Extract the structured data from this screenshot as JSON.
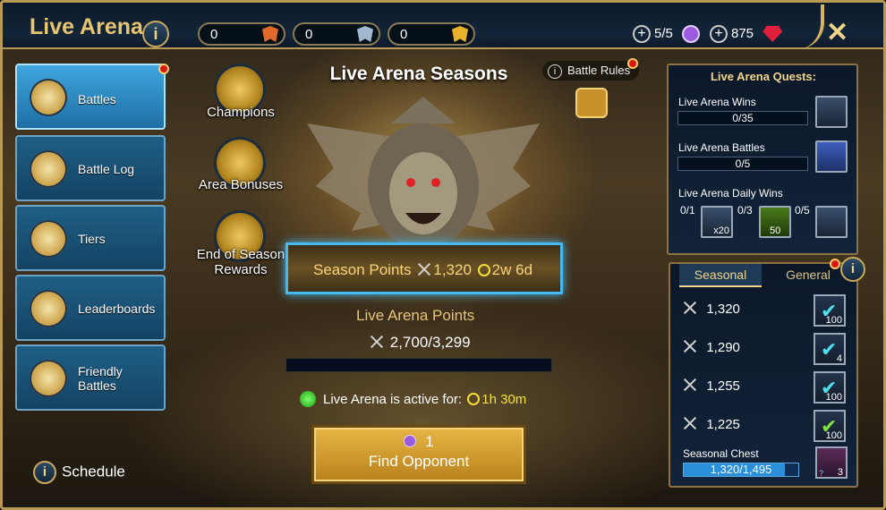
{
  "header": {
    "title": "Live Arena",
    "info_icon": "info-icon",
    "counters": [
      {
        "value": "0",
        "icon": "bronze-badge-icon",
        "color": "#e06a2a"
      },
      {
        "value": "0",
        "icon": "silver-badge-icon",
        "color": "#9fb8d0"
      },
      {
        "value": "0",
        "icon": "gold-badge-icon",
        "color": "#e8b22a"
      }
    ],
    "tokens": "5/5",
    "gems": "875",
    "close_icon": "close-icon"
  },
  "nav": [
    {
      "label": "Battles",
      "icon": "crossed-axes-icon",
      "active": true,
      "notify": true
    },
    {
      "label": "Battle Log",
      "icon": "scroll-icon",
      "active": false
    },
    {
      "label": "Tiers",
      "icon": "trophy-icon",
      "active": false
    },
    {
      "label": "Leaderboards",
      "icon": "double-trophy-icon",
      "active": false
    },
    {
      "label_line1": "Friendly",
      "label_line2": "Battles",
      "icon": "friendly-battles-icon",
      "active": false
    }
  ],
  "center": {
    "title": "Live Arena Seasons",
    "battle_rules": "Battle Rules",
    "champions": "Champions",
    "area_bonuses": "Area Bonuses",
    "end_rewards_1": "End of Season",
    "end_rewards_2": "Rewards",
    "season_points_label": "Season Points",
    "season_points": "1,320",
    "season_time": "2w 6d",
    "arena_points_label": "Live Arena Points",
    "arena_points": "2,700/3,299",
    "arena_progress": 0.0,
    "active_label": "Live Arena is active for:",
    "active_time": "1h 30m",
    "find_cost": "1",
    "find_label": "Find Opponent",
    "schedule": "Schedule"
  },
  "quests": {
    "title": "Live Arena Quests:",
    "items": [
      {
        "label": "Live Arena Wins",
        "progress": "0/35"
      },
      {
        "label": "Live Arena Battles",
        "progress": "0/5"
      }
    ],
    "daily_label": "Live Arena Daily Wins",
    "daily": [
      "0/1",
      "0/3",
      "0/5"
    ],
    "daily_mult": "x20",
    "daily_energy": "50"
  },
  "seasonal": {
    "tab_seasonal": "Seasonal",
    "tab_general": "General",
    "milestones": [
      {
        "points": "1,320",
        "reward": "100"
      },
      {
        "points": "1,290",
        "reward": "4"
      },
      {
        "points": "1,255",
        "reward": "100"
      },
      {
        "points": "1,225",
        "reward": "100"
      }
    ],
    "chest_label": "Seasonal Chest",
    "chest_progress": "1,320/1,495",
    "chest_fraction": 0.883,
    "chest_count": "3",
    "chest_unknown": "?"
  }
}
